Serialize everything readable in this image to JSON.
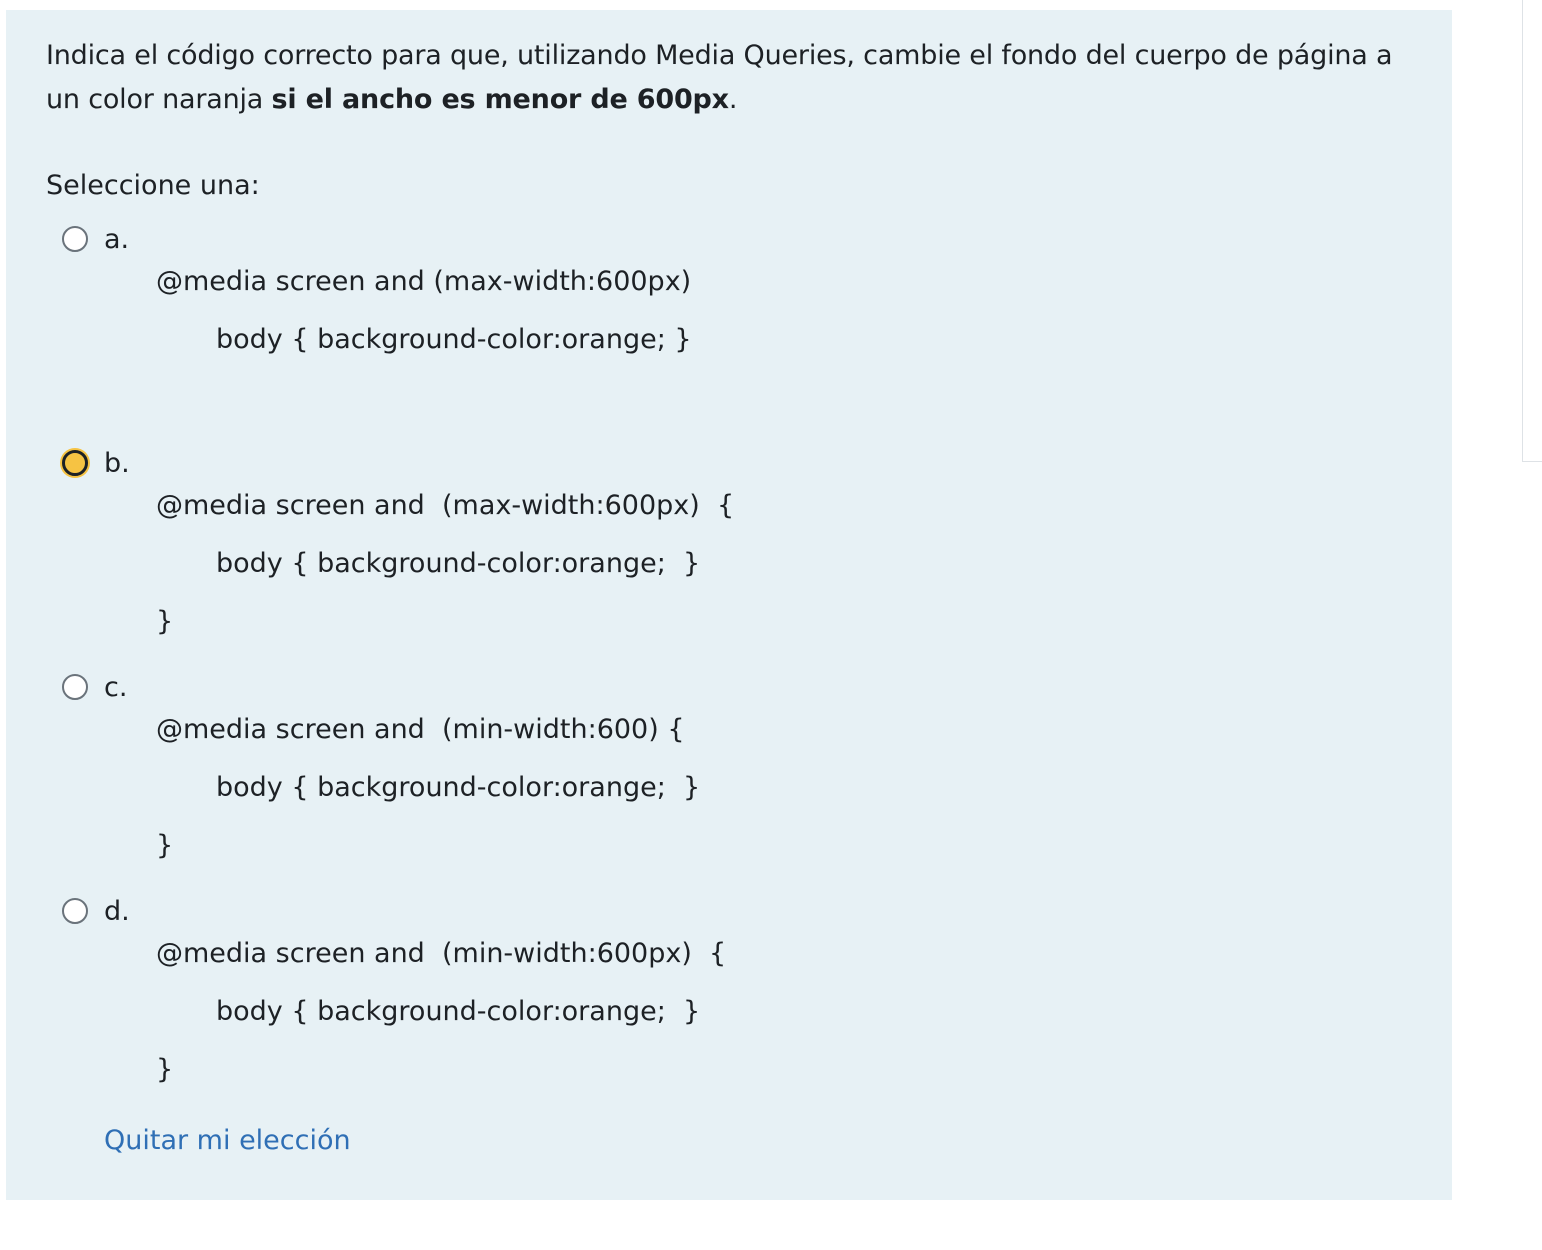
{
  "question": {
    "text_before": "Indica el código correcto para que, utilizando Media Queries, cambie el fondo del cuerpo de página a un color naranja ",
    "text_bold": "si el ancho es menor de 600px",
    "text_after": "."
  },
  "prompt": "Seleccione una:",
  "options": [
    {
      "letter": "a.",
      "selected": false,
      "lines": [
        "@media screen and (max-width:600px)",
        "body { background-color:orange; }"
      ]
    },
    {
      "letter": "b.",
      "selected": true,
      "lines": [
        "@media screen and  (max-width:600px)  {",
        "body { background-color:orange;  }",
        "}"
      ]
    },
    {
      "letter": "c.",
      "selected": false,
      "lines": [
        "@media screen and  (min-width:600) {",
        "body { background-color:orange;  }",
        "}"
      ]
    },
    {
      "letter": "d.",
      "selected": false,
      "lines": [
        "@media screen and  (min-width:600px)  {",
        "body { background-color:orange;  }",
        "}"
      ]
    }
  ],
  "clear_choice_label": "Quitar mi elección",
  "colors": {
    "panel_bg": "#e7f1f5",
    "selected_radio": "#f6c343",
    "link": "#2f6fb5"
  }
}
